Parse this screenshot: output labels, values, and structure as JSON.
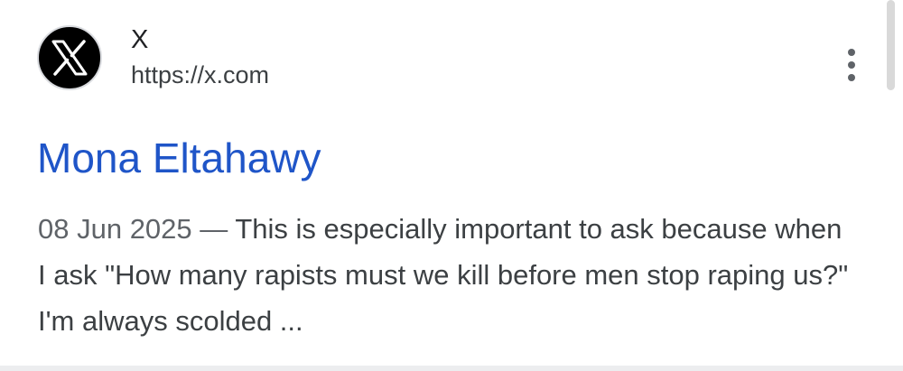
{
  "result": {
    "site_name": "X",
    "site_url": "https://x.com",
    "favicon_icon": "x-logo-icon",
    "more_icon": "more-vert-icon",
    "title": "Mona Eltahawy",
    "date": "08 Jun 2025",
    "separator": " — ",
    "snippet": "This is especially important to ask because when I ask \"How many rapists must we kill before men stop raping us?\" I'm always scolded ..."
  },
  "colors": {
    "title_link": "#1f55c8",
    "snippet_text": "#3c4043",
    "date_text": "#5f6368",
    "favicon_bg": "#000000"
  }
}
